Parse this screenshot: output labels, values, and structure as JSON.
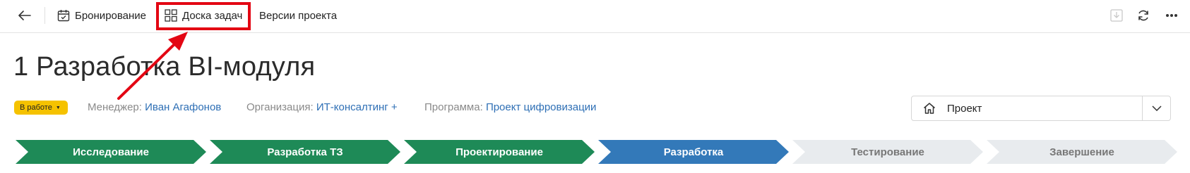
{
  "toolbar": {
    "items": [
      {
        "label": "Бронирование",
        "icon": "calendar-check-icon"
      },
      {
        "label": "Доска задач",
        "icon": "board-grid-icon"
      },
      {
        "label": "Версии проекта"
      }
    ],
    "right_icons": [
      "download-icon",
      "refresh-icon",
      "more-icon"
    ]
  },
  "page": {
    "title": "1 Разработка BI-модуля"
  },
  "status": {
    "label": "В работе",
    "color": "#f5c200"
  },
  "meta": [
    {
      "label": "Менеджер:",
      "value": "Иван Агафонов"
    },
    {
      "label": "Организация:",
      "value": "ИТ-консалтинг +"
    },
    {
      "label": "Программа:",
      "value": "Проект цифровизации"
    }
  ],
  "type_select": {
    "value": "Проект",
    "icon": "home-icon"
  },
  "stages": [
    {
      "label": "Исследование",
      "state": "done"
    },
    {
      "label": "Разработка ТЗ",
      "state": "done"
    },
    {
      "label": "Проектирование",
      "state": "done"
    },
    {
      "label": "Разработка",
      "state": "current"
    },
    {
      "label": "Тестирование",
      "state": "pending"
    },
    {
      "label": "Завершение",
      "state": "pending"
    }
  ],
  "colors": {
    "done": "#1e8a57",
    "current": "#3379b9",
    "pending": "#e8ebee",
    "pending_text": "#777777",
    "highlight": "#e30613",
    "link": "#2e6fb5"
  }
}
